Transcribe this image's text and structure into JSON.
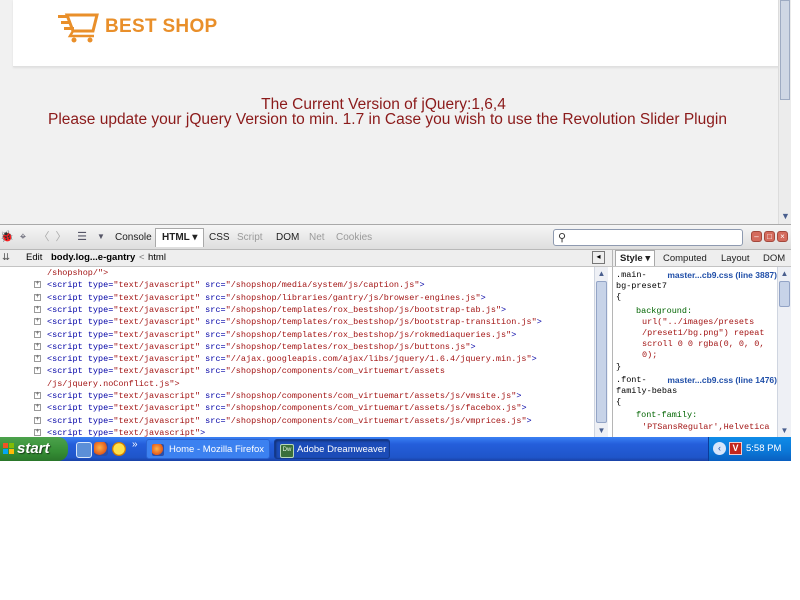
{
  "page": {
    "logo_text": "BEST SHOP",
    "message_version": "The Current Version of jQuery:1,6,4",
    "message_update": "Please update your jQuery Version to min. 1.7 in Case you wish to use the Revolution Slider Plugin"
  },
  "firebug": {
    "tabs": [
      {
        "label": "Console",
        "state": "normal"
      },
      {
        "label": "HTML ▾",
        "state": "active"
      },
      {
        "label": "CSS",
        "state": "normal"
      },
      {
        "label": "Script",
        "state": "disabled"
      },
      {
        "label": "DOM",
        "state": "normal"
      },
      {
        "label": "Net",
        "state": "disabled"
      },
      {
        "label": "Cookies",
        "state": "disabled"
      }
    ],
    "search_placeholder": "",
    "breadcrumb": {
      "edit_label": "Edit",
      "current": "body.log...e-gantry",
      "separator": "<",
      "parent": "html"
    },
    "side_tabs": [
      {
        "label": "Style ▾",
        "state": "active"
      },
      {
        "label": "Computed",
        "state": "normal"
      },
      {
        "label": "Layout",
        "state": "normal"
      },
      {
        "label": "DOM",
        "state": "normal"
      }
    ],
    "html_lines": [
      {
        "kind": "cont",
        "text": "/shopshop/\">"
      },
      {
        "kind": "script",
        "type": "text/javascript",
        "src": "/shopshop/media/system/js/caption.js"
      },
      {
        "kind": "script",
        "type": "text/javascript",
        "src": "/shopshop/libraries/gantry/js/browser-engines.js"
      },
      {
        "kind": "script",
        "type": "text/javascript",
        "src": "/shopshop/templates/rox_bestshop/js/bootstrap-tab.js"
      },
      {
        "kind": "script",
        "type": "text/javascript",
        "src": "/shopshop/templates/rox_bestshop/js/bootstrap-transition.js"
      },
      {
        "kind": "script",
        "type": "text/javascript",
        "src": "/shopshop/templates/rox_bestshop/js/rokmediaqueries.js"
      },
      {
        "kind": "script",
        "type": "text/javascript",
        "src": "/shopshop/templates/rox_bestshop/js/buttons.js"
      },
      {
        "kind": "script",
        "type": "text/javascript",
        "src": "//ajax.googleapis.com/ajax/libs/jquery/1.6.4/jquery.min.js"
      },
      {
        "kind": "script-open",
        "type": "text/javascript",
        "src": "/shopshop/components/com_virtuemart/assets"
      },
      {
        "kind": "cont",
        "text": "/js/jquery.noConflict.js\">"
      },
      {
        "kind": "script",
        "type": "text/javascript",
        "src": "/shopshop/components/com_virtuemart/assets/js/vmsite.js"
      },
      {
        "kind": "script",
        "type": "text/javascript",
        "src": "/shopshop/components/com_virtuemart/assets/js/facebox.js"
      },
      {
        "kind": "script",
        "type": "text/javascript",
        "src": "/shopshop/components/com_virtuemart/assets/js/vmprices.js"
      },
      {
        "kind": "script-bare",
        "type": "text/javascript"
      }
    ],
    "css_rules": [
      {
        "selector_1": ".main-",
        "selector_2": "bg-preset7",
        "source": "master...cb9.css (line 3887)",
        "open": "{",
        "prop": "background:",
        "values": [
          "url(\"../images/presets",
          "/preset1/bg.png\") repeat",
          "scroll 0 0 rgba(0, 0, 0,",
          "0);"
        ],
        "close": "}"
      },
      {
        "selector_1": ".font-",
        "selector_2": "family-bebas",
        "source": "master...cb9.css (line 1476)",
        "open": "{",
        "prop": "font-family:",
        "values": [
          "'PTSansRegular',Helvetica"
        ]
      }
    ]
  },
  "taskbar": {
    "start_label": "start",
    "more_label": "»",
    "tasks": [
      {
        "label": "Home - Mozilla Firefox",
        "icon": "firefox-icon",
        "active": false
      },
      {
        "label": "Adobe Dreamweaver ...",
        "icon": "dreamweaver-icon",
        "active": true
      }
    ],
    "clock": "5:58 PM"
  },
  "colors": {
    "logo": "#e98f2a",
    "message": "#8b1a1a",
    "taskbar": "#245edb",
    "start": "#358e35"
  }
}
